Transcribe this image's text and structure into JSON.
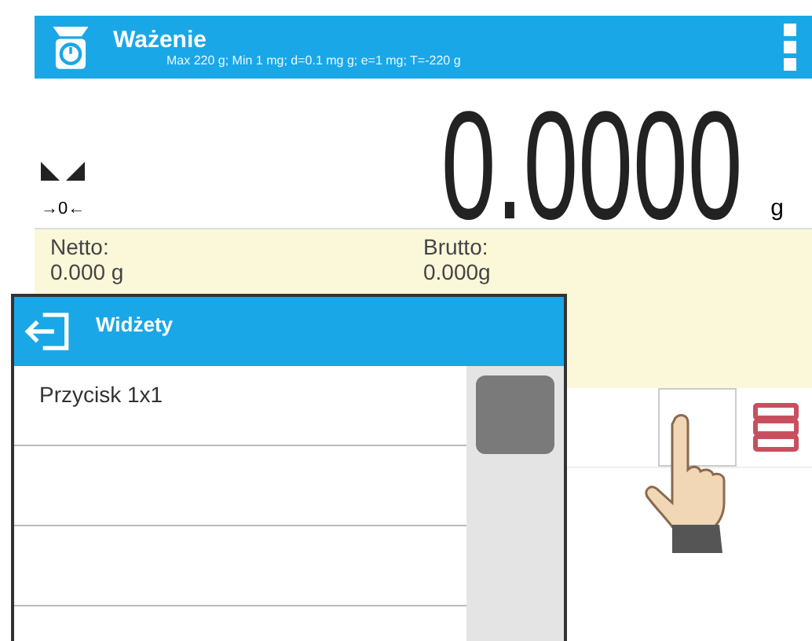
{
  "header": {
    "title": "Ważenie",
    "subtitle": "Max 220 g; Min 1 mg; d=0.1 mg g; e=1 mg; T=-220 g"
  },
  "readout": {
    "zero_mark": "→0←",
    "value": "0.0000",
    "unit": "g"
  },
  "info": [
    {
      "label": "Netto:",
      "value": "0.000 g"
    },
    {
      "label": "Brutto:",
      "value": "0.000g"
    }
  ],
  "popup": {
    "title": "Widżety",
    "items": [
      {
        "label": "Przycisk 1x1"
      }
    ]
  }
}
